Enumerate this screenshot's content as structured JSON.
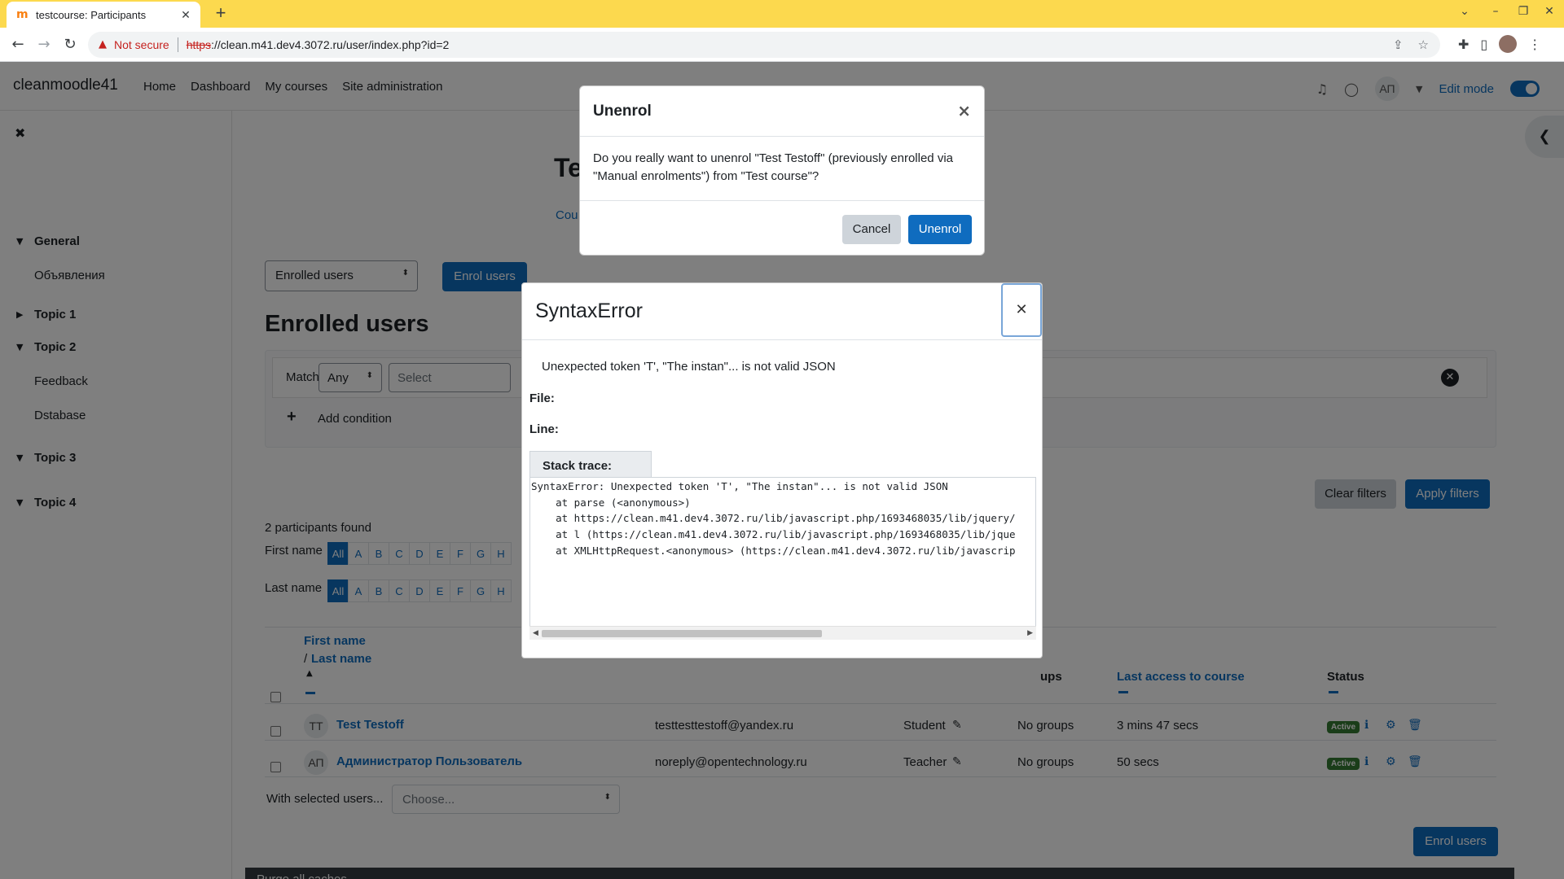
{
  "browser": {
    "tab_title": "testcourse: Participants",
    "tab_favicon": "moodle-favicon",
    "new_tab": "+",
    "not_secure": "Not secure",
    "url_scheme": "https",
    "url_rest": "://clean.m41.dev4.3072.ru/user/index.php?id=2"
  },
  "navbar": {
    "brand": "cleanmoodle41",
    "items": [
      "Home",
      "Dashboard",
      "My courses",
      "Site administration"
    ],
    "user_initials": "АП",
    "edit_mode": "Edit mode"
  },
  "course_index": {
    "sections": [
      {
        "title": "General",
        "expanded": true,
        "items": [
          "Объявления"
        ]
      },
      {
        "title": "Topic 1",
        "expanded": false,
        "items": []
      },
      {
        "title": "Topic 2",
        "expanded": true,
        "items": [
          "Feedback",
          "Dstabase"
        ]
      },
      {
        "title": "Topic 3",
        "expanded": true,
        "items": []
      },
      {
        "title": "Topic 4",
        "expanded": true,
        "items": []
      }
    ]
  },
  "main": {
    "heading_fragment": "Te",
    "course_link_fragment": "Cou",
    "enrolled_select": "Enrolled users",
    "enrol_button": "Enrol users",
    "enrolled_heading": "Enrolled users",
    "filter": {
      "match_label": "Match",
      "match_value": "Any",
      "select_placeholder": "Select",
      "add_condition": "Add condition",
      "clear_filters": "Clear filters",
      "apply_filters": "Apply filters"
    },
    "participants_found": "2 participants found",
    "first_name_label": "First name",
    "last_name_label": "Last name",
    "initials_all": "All",
    "initials_letters": [
      "A",
      "B",
      "C",
      "D",
      "E",
      "F",
      "G",
      "H"
    ],
    "table": {
      "first_name": "First name",
      "slash": "/ ",
      "last_name": "Last name",
      "groups_fragment": "ups",
      "last_access": "Last access to course",
      "status": "Status",
      "rows": [
        {
          "initials": "TT",
          "name": "Test Testoff",
          "email": "testtesttestoff@yandex.ru",
          "role": "Student",
          "groups": "No groups",
          "last_access": "3 mins 47 secs",
          "status": "Active"
        },
        {
          "initials": "АП",
          "name": "Администратор Пользователь",
          "email": "noreply@opentechnology.ru",
          "role": "Teacher",
          "groups": "No groups",
          "last_access": "50 secs",
          "status": "Active"
        }
      ]
    },
    "with_selected": "With selected users...",
    "choose_placeholder": "Choose...",
    "enrol_bottom": "Enrol users",
    "help": "?",
    "footer_text": "Purge all caches"
  },
  "unenrol_modal": {
    "title": "Unenrol",
    "body": "Do you really want to unenrol \"Test Testoff\" (previously enrolled via \"Manual enrolments\") from \"Test course\"?",
    "cancel": "Cancel",
    "confirm": "Unenrol"
  },
  "error_modal": {
    "title": "SyntaxError",
    "message": "Unexpected token 'T', \"The instan\"... is not valid JSON",
    "file_label": "File:",
    "line_label": "Line:",
    "stack_label": "Stack trace:",
    "stack_trace": "SyntaxError: Unexpected token 'T', \"The instan\"... is not valid JSON\n    at parse (<anonymous>)\n    at https://clean.m41.dev4.3072.ru/lib/javascript.php/1693468035/lib/jquery/\n    at l (https://clean.m41.dev4.3072.ru/lib/javascript.php/1693468035/lib/jque\n    at XMLHttpRequest.<anonymous> (https://clean.m41.dev4.3072.ru/lib/javascrip"
  },
  "colors": {
    "browser_frame": "#fcd94e",
    "primary": "#0f6cbf",
    "badge_active": "#357a32",
    "not_secure": "#c5221f"
  }
}
